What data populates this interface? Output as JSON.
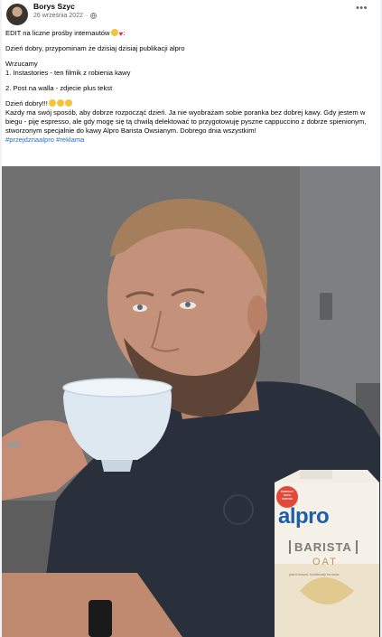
{
  "post": {
    "author": "Borys Szyc",
    "date": "26 września 2022",
    "more_label": "•••",
    "line_edit": "EDIT na liczne prośby internautów",
    "line_edit_suffix": ":",
    "line_reminder": "Dzień dobry, przypominam że dzisiaj dzisiaj publikacji alpro",
    "line_wrzucamy": "Wrzucamy",
    "line_item1": "1. Instastories - ten filmik z robienia kawy",
    "line_item2": "2. Post na walla - zdjecie plus tekst",
    "line_greeting": "Dzień dobry!!!",
    "paragraph": "Każdy ma swój sposób, aby dobrze rozpocząć dzień. Ja nie wyobrażam sobie poranka bez dobrej kawy. Gdy jestem w biegu - piję espresso, ale gdy mogę się tą chwilą delektować to przygotowuję pyszne cappuccino z dobrze spienionym, stworzonym specjalnie do kawy Alpro Barista Owsianym. Dobrego dnia wszystkim!",
    "hashtags": "#przejdznaalpro #reklama"
  },
  "photo": {
    "carton_badge": "PERFECT WITH COFFEE",
    "carton_brand": "alpro",
    "carton_product": "BARISTA",
    "carton_variant": "OAT",
    "carton_subtitle": "plant-based, foodready formula"
  },
  "colors": {
    "hashtag": "#216fdb",
    "brand_blue": "#1c5fa8",
    "meta": "#65676b"
  }
}
